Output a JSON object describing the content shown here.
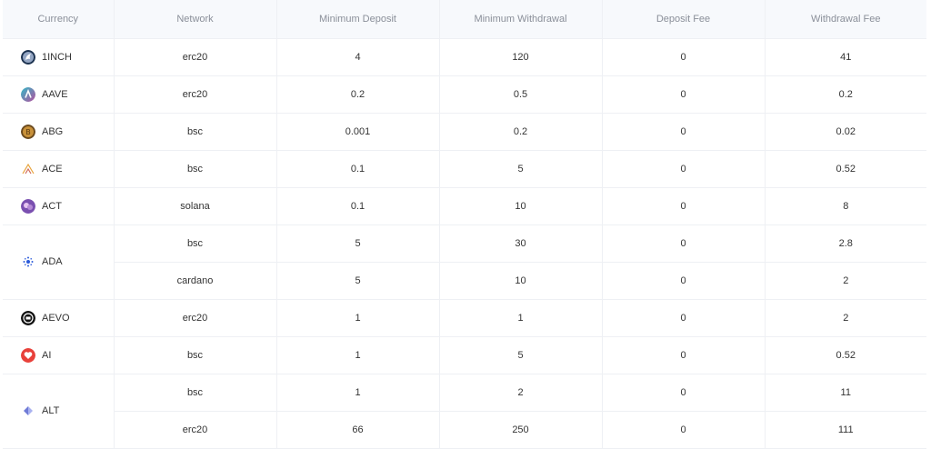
{
  "headers": {
    "currency": "Currency",
    "network": "Network",
    "min_deposit": "Minimum Deposit",
    "min_withdrawal": "Minimum Withdrawal",
    "deposit_fee": "Deposit Fee",
    "withdrawal_fee": "Withdrawal Fee"
  },
  "coins": [
    {
      "symbol": "1INCH",
      "icon": "1inch-icon",
      "rows": [
        {
          "network": "erc20",
          "min_deposit": "4",
          "min_withdrawal": "120",
          "deposit_fee": "0",
          "withdrawal_fee": "41"
        }
      ]
    },
    {
      "symbol": "AAVE",
      "icon": "aave-icon",
      "rows": [
        {
          "network": "erc20",
          "min_deposit": "0.2",
          "min_withdrawal": "0.5",
          "deposit_fee": "0",
          "withdrawal_fee": "0.2"
        }
      ]
    },
    {
      "symbol": "ABG",
      "icon": "abg-icon",
      "rows": [
        {
          "network": "bsc",
          "min_deposit": "0.001",
          "min_withdrawal": "0.2",
          "deposit_fee": "0",
          "withdrawal_fee": "0.02"
        }
      ]
    },
    {
      "symbol": "ACE",
      "icon": "ace-icon",
      "rows": [
        {
          "network": "bsc",
          "min_deposit": "0.1",
          "min_withdrawal": "5",
          "deposit_fee": "0",
          "withdrawal_fee": "0.52"
        }
      ]
    },
    {
      "symbol": "ACT",
      "icon": "act-icon",
      "rows": [
        {
          "network": "solana",
          "min_deposit": "0.1",
          "min_withdrawal": "10",
          "deposit_fee": "0",
          "withdrawal_fee": "8"
        }
      ]
    },
    {
      "symbol": "ADA",
      "icon": "ada-icon",
      "rows": [
        {
          "network": "bsc",
          "min_deposit": "5",
          "min_withdrawal": "30",
          "deposit_fee": "0",
          "withdrawal_fee": "2.8"
        },
        {
          "network": "cardano",
          "min_deposit": "5",
          "min_withdrawal": "10",
          "deposit_fee": "0",
          "withdrawal_fee": "2"
        }
      ]
    },
    {
      "symbol": "AEVO",
      "icon": "aevo-icon",
      "rows": [
        {
          "network": "erc20",
          "min_deposit": "1",
          "min_withdrawal": "1",
          "deposit_fee": "0",
          "withdrawal_fee": "2"
        }
      ]
    },
    {
      "symbol": "AI",
      "icon": "ai-heart-icon",
      "rows": [
        {
          "network": "bsc",
          "min_deposit": "1",
          "min_withdrawal": "5",
          "deposit_fee": "0",
          "withdrawal_fee": "0.52"
        }
      ]
    },
    {
      "symbol": "ALT",
      "icon": "alt-icon",
      "rows": [
        {
          "network": "bsc",
          "min_deposit": "1",
          "min_withdrawal": "2",
          "deposit_fee": "0",
          "withdrawal_fee": "11"
        },
        {
          "network": "erc20",
          "min_deposit": "66",
          "min_withdrawal": "250",
          "deposit_fee": "0",
          "withdrawal_fee": "111"
        }
      ]
    }
  ],
  "colors": {
    "header_bg": "#f7f9fc",
    "header_text": "#8a8f99",
    "grid_line": "#eef0f4",
    "cell_text": "#333333"
  }
}
